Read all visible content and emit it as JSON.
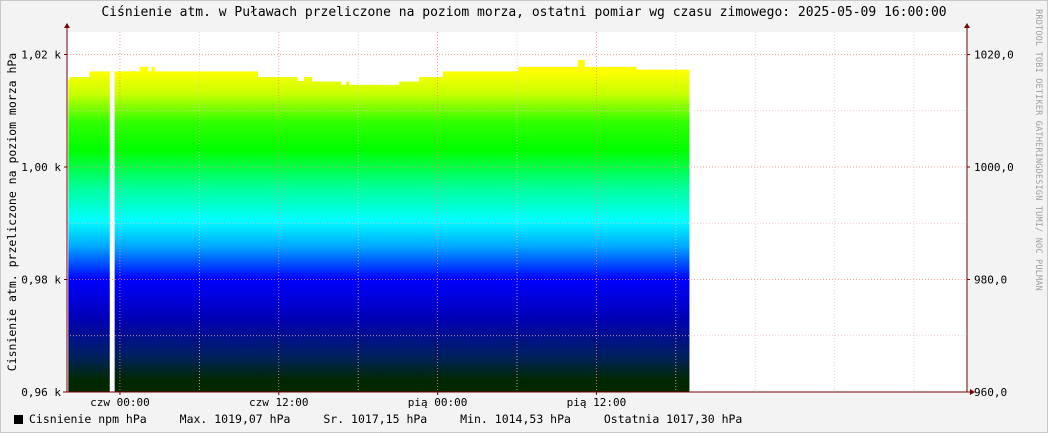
{
  "chart_data": {
    "type": "area",
    "title": "Ciśnienie atm. w Puławach przeliczone na poziom morza, ostatni pomiar wg czasu zimowego: 2025-05-09 16:00:00",
    "ylabel": "Cisnienie atm. przeliczone na poziom morza hPa",
    "watermark": "RRDTOOL TOBI OETIKER  GATHERINGDESIGN TUMI/ NOC PULMAN",
    "ylim": [
      960,
      1024
    ],
    "yticks_left": [
      {
        "value": 960,
        "label": "0,96 k"
      },
      {
        "value": 980,
        "label": "0,98 k"
      },
      {
        "value": 1000,
        "label": "1,00 k"
      },
      {
        "value": 1020,
        "label": "1,02 k"
      }
    ],
    "yticks_right": [
      {
        "value": 960,
        "label": "960,0"
      },
      {
        "value": 980,
        "label": "980,0"
      },
      {
        "value": 1000,
        "label": "1000,0"
      },
      {
        "value": 1020,
        "label": "1020,0"
      }
    ],
    "xlim": [
      -28,
      40
    ],
    "xticks": [
      {
        "hour": -24,
        "label": "czw 00:00"
      },
      {
        "hour": -12,
        "label": "czw 12:00"
      },
      {
        "hour": 0,
        "label": "pią 00:00"
      },
      {
        "hour": 12,
        "label": "pią 12:00"
      }
    ],
    "gradient_stops": [
      {
        "value": 1017.0,
        "color": "#ffff00"
      },
      {
        "value": 1013.0,
        "color": "#c8ff00"
      },
      {
        "value": 1008.0,
        "color": "#32ff00"
      },
      {
        "value": 1003.0,
        "color": "#00ff00"
      },
      {
        "value": 996.0,
        "color": "#00ffa0"
      },
      {
        "value": 990.5,
        "color": "#00ffff"
      },
      {
        "value": 986.0,
        "color": "#00aaff"
      },
      {
        "value": 980.0,
        "color": "#0000ff"
      },
      {
        "value": 973.0,
        "color": "#0000b4"
      },
      {
        "value": 966.5,
        "color": "#002060"
      },
      {
        "value": 962.0,
        "color": "#002800"
      }
    ],
    "series": [
      {
        "name": "Cisnienie npm hPa",
        "segments": [
          {
            "x0": -27.9,
            "x1": -27.8,
            "y": 1015.5
          },
          {
            "x0": -27.8,
            "x1": -26.3,
            "y": 1016.0
          },
          {
            "x0": -26.3,
            "x1": -24.8,
            "y": 1017.0
          },
          {
            "x0": -24.8,
            "x1": -24.4,
            "y": null
          },
          {
            "x0": -24.4,
            "x1": -22.5,
            "y": 1017.0
          },
          {
            "x0": -22.5,
            "x1": -21.9,
            "y": 1017.8
          },
          {
            "x0": -21.9,
            "x1": -21.6,
            "y": 1017.0
          },
          {
            "x0": -21.6,
            "x1": -21.4,
            "y": 1017.8
          },
          {
            "x0": -21.4,
            "x1": -13.6,
            "y": 1017.0
          },
          {
            "x0": -13.6,
            "x1": -10.6,
            "y": 1016.0
          },
          {
            "x0": -10.6,
            "x1": -10.1,
            "y": 1015.3
          },
          {
            "x0": -10.1,
            "x1": -9.5,
            "y": 1016.0
          },
          {
            "x0": -9.5,
            "x1": -7.3,
            "y": 1015.2
          },
          {
            "x0": -7.3,
            "x1": -6.9,
            "y": 1014.6
          },
          {
            "x0": -6.9,
            "x1": -6.7,
            "y": 1015.2
          },
          {
            "x0": -6.7,
            "x1": -2.9,
            "y": 1014.6
          },
          {
            "x0": -2.9,
            "x1": -1.4,
            "y": 1015.2
          },
          {
            "x0": -1.4,
            "x1": 0.4,
            "y": 1016.0
          },
          {
            "x0": 0.4,
            "x1": 6.1,
            "y": 1017.0
          },
          {
            "x0": 6.1,
            "x1": 10.6,
            "y": 1017.8
          },
          {
            "x0": 10.6,
            "x1": 11.1,
            "y": 1019.0
          },
          {
            "x0": 11.1,
            "x1": 15.0,
            "y": 1017.8
          },
          {
            "x0": 15.0,
            "x1": 19.0,
            "y": 1017.3
          }
        ]
      }
    ]
  },
  "legend": {
    "series_name": "Cisnienie npm hPa",
    "max": "Max. 1019,07 hPa",
    "avg": "Sr. 1017,15 hPa",
    "min": "Min. 1014,53 hPa",
    "last": "Ostatnia 1017,30 hPa"
  },
  "colors": {
    "background": "#f3f3f3",
    "grid_major": "#ff8080",
    "grid_minor": "#f0c0c0",
    "axis": "#7b0000"
  }
}
